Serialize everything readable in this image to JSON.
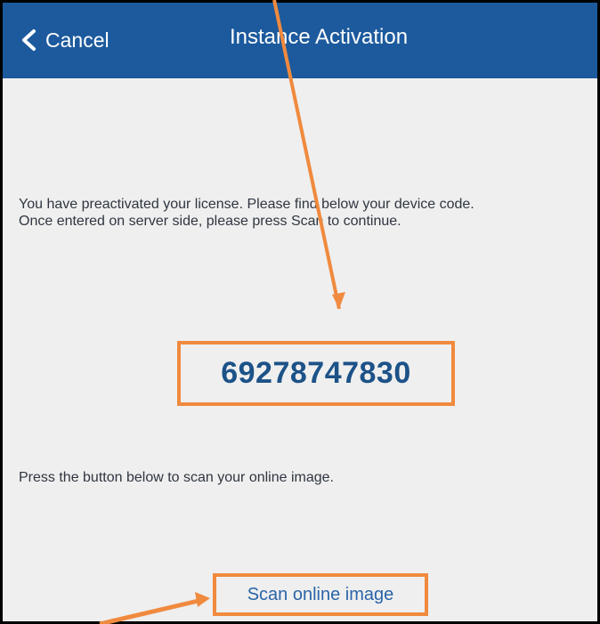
{
  "navbar": {
    "back_label": "Cancel",
    "title": "Instance Activation"
  },
  "content": {
    "message": "You have preactivated your license. Please find below your device code.\nOnce entered on server side, please press Scan to continue.",
    "device_code": "69278747830",
    "scan_instruction": "Press the button below to scan your online image.",
    "scan_button_label": "Scan online image"
  },
  "colors": {
    "navbar": "#1c5a9d",
    "background": "#efefef",
    "code_text": "#1c5288",
    "link_text": "#2a64a8",
    "annotation_orange": "#f08a3e"
  },
  "icons": {
    "back": "chevron-left-icon"
  }
}
